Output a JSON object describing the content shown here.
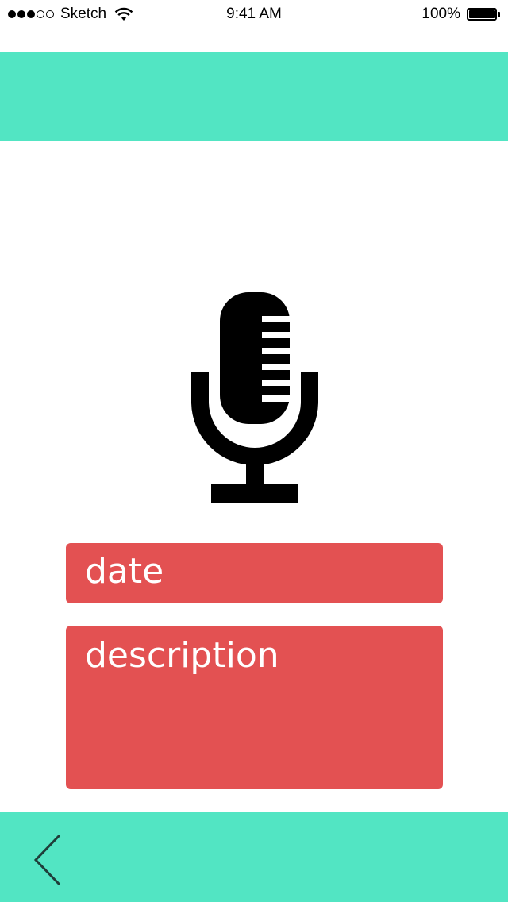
{
  "status_bar": {
    "carrier": "Sketch",
    "time": "9:41 AM",
    "battery_percent": "100%",
    "signal_strength": 3,
    "signal_max": 5,
    "battery_level": 1.0
  },
  "colors": {
    "accent": "#52e5c3",
    "field": "#e35152",
    "icon": "#000000"
  },
  "recorder": {
    "icon": "microphone-icon"
  },
  "form": {
    "date_placeholder": "date",
    "description_placeholder": "description"
  },
  "footer": {
    "back_icon": "chevron-left-icon"
  }
}
